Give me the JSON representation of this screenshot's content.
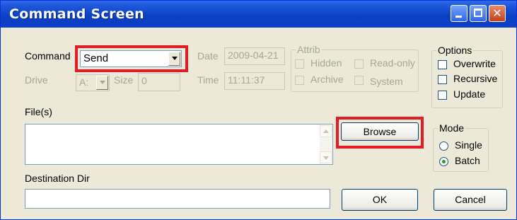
{
  "window": {
    "title": "Command Screen"
  },
  "command": {
    "label": "Command",
    "value": "Send"
  },
  "drive": {
    "label": "Drive",
    "value": "A:"
  },
  "size": {
    "label": "Size",
    "value": "0"
  },
  "date": {
    "label": "Date",
    "value": "2009-04-21"
  },
  "time": {
    "label": "Time",
    "value": "11:11:37"
  },
  "attrib": {
    "title": "Attrib",
    "hidden": "Hidden",
    "readonly": "Read-only",
    "archive": "Archive",
    "system": "System"
  },
  "options": {
    "title": "Options",
    "overwrite": "Overwrite",
    "recursive": "Recursive",
    "update": "Update"
  },
  "files": {
    "label": "File(s)",
    "value": ""
  },
  "browse": {
    "label": "Browse"
  },
  "mode": {
    "title": "Mode",
    "single": "Single",
    "batch": "Batch",
    "selected": "Batch"
  },
  "destination": {
    "label": "Destination Dir",
    "value": ""
  },
  "ok": {
    "label": "OK"
  },
  "cancel": {
    "label": "Cancel"
  },
  "colors": {
    "highlight": "#E31B23",
    "titlebar": "#0A3FC4",
    "window_bg": "#ECE9D8"
  }
}
